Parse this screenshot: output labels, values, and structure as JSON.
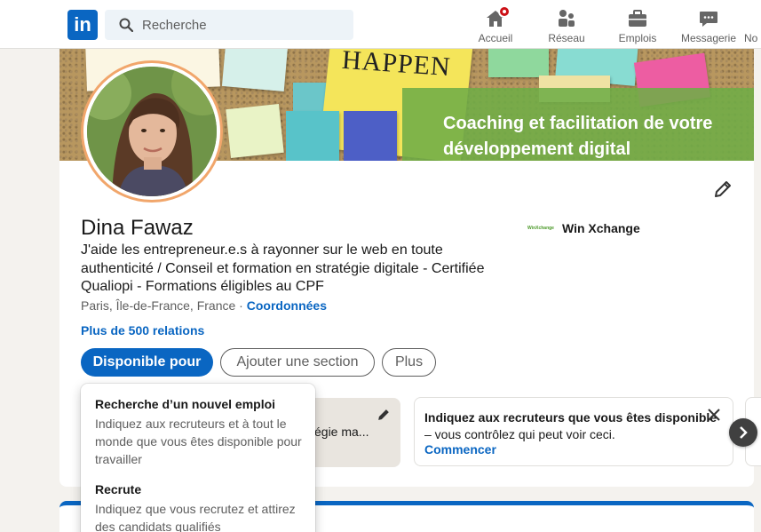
{
  "nav": {
    "search_placeholder": "Recherche",
    "items": [
      {
        "label": "Accueil",
        "icon": "home-icon"
      },
      {
        "label": "Réseau",
        "icon": "network-icon"
      },
      {
        "label": "Emplois",
        "icon": "briefcase-icon"
      },
      {
        "label": "Messagerie",
        "icon": "messaging-icon"
      },
      {
        "label": "No",
        "icon": "notifications-icon"
      }
    ],
    "brand_color": "#0a66c2"
  },
  "banner": {
    "note_text": "HAPPEN",
    "tagline_line1": "Coaching et facilitation de votre",
    "tagline_line2": "développement digital"
  },
  "profile": {
    "name": "Dina Fawaz",
    "headline": "J'aide les entrepreneur.e.s à rayonner sur le web en toute authenticité / Conseil et formation en stratégie digitale - Certifiée Qualiopi - Formations éligibles au CPF",
    "location": "Paris, Île-de-France, France",
    "location_separator": " · ",
    "contact_link": "Coordonnées",
    "connections": "Plus de 500 relations",
    "company": "Win Xchange",
    "company_logo_text": "WinXchange"
  },
  "actions": {
    "available": "Disponible pour",
    "add_section": "Ajouter une section",
    "more": "Plus"
  },
  "cards": {
    "partial_text": "égie ma...",
    "info_title": "Indiquez aux recruteurs que vous êtes disponible",
    "info_sub": "– vous contrôlez qui peut voir ceci.",
    "info_link": "Commencer"
  },
  "dropdown": {
    "items": [
      {
        "title": "Recherche d’un nouvel emploi",
        "desc": "Indiquez aux recruteurs et à tout le monde que vous êtes disponible pour travailler"
      },
      {
        "title": "Recrute",
        "desc": "Indiquez que vous recrutez et attirez des candidats qualifiés"
      }
    ]
  }
}
